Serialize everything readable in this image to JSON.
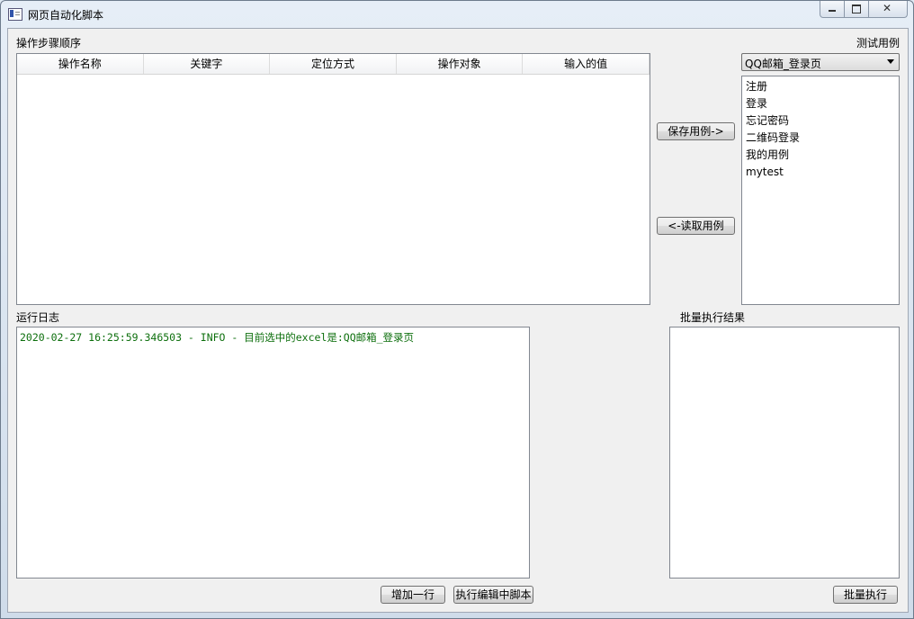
{
  "window": {
    "title": "网页自动化脚本"
  },
  "steps_section": {
    "label": "操作步骤顺序",
    "columns": [
      "操作名称",
      "关键字",
      "定位方式",
      "操作对象",
      "输入的值"
    ]
  },
  "cases_section": {
    "label": "测试用例",
    "selected_excel": "QQ邮箱_登录页",
    "items": [
      "注册",
      "登录",
      "忘记密码",
      "二维码登录",
      "我的用例",
      "mytest"
    ]
  },
  "buttons": {
    "save_case": "保存用例->",
    "read_case": "<-读取用例",
    "add_row": "增加一行",
    "run_script": "执行编辑中脚本",
    "batch_run": "批量执行"
  },
  "log_section": {
    "label": "运行日志",
    "lines": [
      "2020-02-27 16:25:59.346503 - INFO - 目前选中的excel是:QQ邮箱_登录页"
    ],
    "text_color": "#0d6f0d"
  },
  "batch_section": {
    "label": "批量执行结果"
  }
}
